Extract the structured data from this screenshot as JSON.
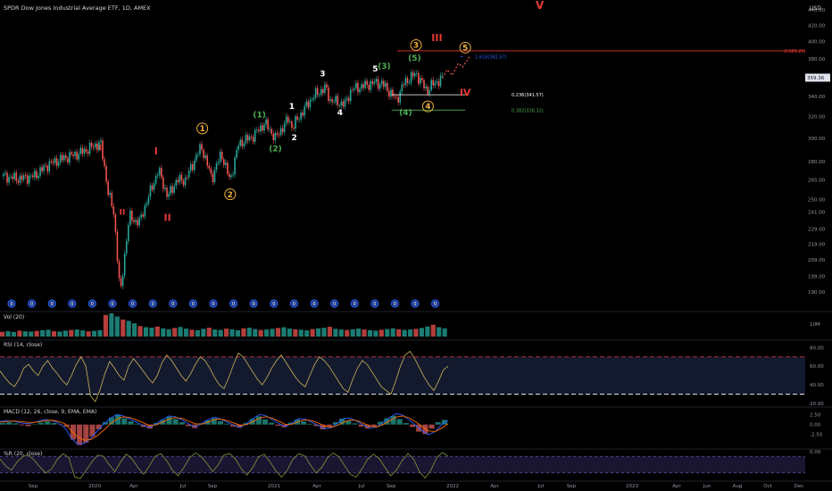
{
  "header": {
    "title": "SPDR Dow Jones Industrial Average ETF, 1D, AMEX",
    "currency": "USD"
  },
  "colors": {
    "background": "#000000",
    "candle_up": "#26a69a",
    "candle_down": "#ef5350",
    "rsi_line": "#c9b458",
    "macd_line": "#2962ff",
    "signal_line": "#ff6d00",
    "wr_line": "#7e9c3c",
    "wave_orange": "#f0b040",
    "wave_red": "#e53935",
    "wave_green": "#4caf50",
    "wave_white": "#ffffff",
    "fib_blue": "#2962ff"
  },
  "price_axis": {
    "ticks": [
      "440.00",
      "420.00",
      "400.00",
      "380.00",
      "360.00",
      "340.00",
      "320.00",
      "300.00",
      "280.00",
      "265.00",
      "250.00",
      "241.00",
      "229.00",
      "219.00",
      "209.00",
      "199.00",
      "190.00"
    ],
    "last_price": "359.36"
  },
  "time_axis": {
    "labels": [
      "Sep",
      "2020",
      "Apr",
      "Jul",
      "Sep",
      "2021",
      "Apr",
      "Jul",
      "Sep",
      "2022",
      "Apr",
      "Jul",
      "Sep",
      "2023",
      "Apr",
      "Jun",
      "Aug",
      "Oct",
      "Dec"
    ]
  },
  "chart_data": [
    {
      "type": "line",
      "title": "SPDR Dow Jones Industrial Average ETF, 1D, AMEX",
      "subtitle": "candlestick",
      "x_unit": "date",
      "series": [
        {
          "name": "",
          "values": [
            {
              "x": "2019-08-01",
              "y": 268
            },
            {
              "x": "2019-09-01",
              "y": 266
            },
            {
              "x": "2019-10-01",
              "y": 268
            },
            {
              "x": "2019-11-01",
              "y": 278
            },
            {
              "x": "2019-12-01",
              "y": 283
            },
            {
              "x": "2020-01-01",
              "y": 287
            },
            {
              "x": "2020-02-12",
              "y": 296
            },
            {
              "x": "2020-02-28",
              "y": 255
            },
            {
              "x": "2020-03-10",
              "y": 240
            },
            {
              "x": "2020-03-23",
              "y": 187
            },
            {
              "x": "2020-04-10",
              "y": 238
            },
            {
              "x": "2020-04-20",
              "y": 235
            },
            {
              "x": "2020-05-01",
              "y": 234
            },
            {
              "x": "2020-06-08",
              "y": 273
            },
            {
              "x": "2020-06-26",
              "y": 252
            },
            {
              "x": "2020-07-15",
              "y": 265
            },
            {
              "x": "2020-08-01",
              "y": 265
            },
            {
              "x": "2020-09-02",
              "y": 293
            },
            {
              "x": "2020-09-23",
              "y": 266
            },
            {
              "x": "2020-10-12",
              "y": 287
            },
            {
              "x": "2020-10-30",
              "y": 264
            },
            {
              "x": "2020-11-16",
              "y": 295
            },
            {
              "x": "2020-12-15",
              "y": 302
            },
            {
              "x": "2021-01-08",
              "y": 314
            },
            {
              "x": "2021-01-29",
              "y": 300
            },
            {
              "x": "2021-02-24",
              "y": 318
            },
            {
              "x": "2021-03-04",
              "y": 310
            },
            {
              "x": "2021-04-15",
              "y": 340
            },
            {
              "x": "2021-05-10",
              "y": 349
            },
            {
              "x": "2021-05-19",
              "y": 336
            },
            {
              "x": "2021-06-18",
              "y": 332
            },
            {
              "x": "2021-07-01",
              "y": 347
            },
            {
              "x": "2021-08-16",
              "y": 354
            },
            {
              "x": "2021-09-01",
              "y": 353
            },
            {
              "x": "2021-09-30",
              "y": 336
            },
            {
              "x": "2021-10-15",
              "y": 354
            },
            {
              "x": "2021-11-08",
              "y": 364
            },
            {
              "x": "2021-11-30",
              "y": 345
            },
            {
              "x": "2021-12-06",
              "y": 350
            },
            {
              "x": "2021-12-17",
              "y": 354
            },
            {
              "x": "2021-12-31",
              "y": 359
            }
          ]
        }
      ],
      "projection": [
        {
          "x": "2021-12-31",
          "y": 359
        },
        {
          "x": "2022-01-10",
          "y": 368
        },
        {
          "x": "2022-01-20",
          "y": 362
        },
        {
          "x": "2022-02-01",
          "y": 375
        },
        {
          "x": "2022-02-10",
          "y": 371
        },
        {
          "x": "2022-02-24",
          "y": 383
        }
      ],
      "ylim": [
        185,
        448
      ],
      "xlim": [
        "2019-07-25",
        "2023-12-31"
      ],
      "y_scale": "log",
      "grid": false,
      "levels": [
        {
          "label": "2(389.26)",
          "y": 389.26,
          "color": "#e53935",
          "from": "2021-10-01",
          "to": "2023-12-31"
        },
        {
          "label": "1.618(382.57)",
          "y": 382.57,
          "color": "#2962ff",
          "from": "2022-02-05",
          "to": "2022-02-10"
        },
        {
          "label": "0.236(341.57)",
          "y": 341.57,
          "color": "#ffffff",
          "from": "2021-09-20",
          "to": "2022-02-15"
        },
        {
          "label": "0.382(326.32)",
          "y": 326.32,
          "color": "#4caf50",
          "from": "2021-09-20",
          "to": "2022-02-15"
        }
      ],
      "annotations": [
        {
          "text": "V",
          "x": "2022-07-15",
          "y": 446,
          "color": "#e53935",
          "size": 12,
          "circled": false
        },
        {
          "text": "III",
          "x": "2021-12-20",
          "y": 405,
          "color": "#e53935",
          "size": 11,
          "circled": false
        },
        {
          "text": "IV",
          "x": "2022-02-15",
          "y": 344,
          "color": "#e53935",
          "size": 11,
          "circled": false
        },
        {
          "text": "I",
          "x": "2020-06-03",
          "y": 289,
          "color": "#e53935",
          "size": 11,
          "circled": false
        },
        {
          "text": "II",
          "x": "2020-06-26",
          "y": 237,
          "color": "#e53935",
          "size": 11,
          "circled": false
        },
        {
          "text": "I",
          "x": "2020-02-12",
          "y": 292,
          "color": "#e53935",
          "size": 9,
          "circled": false
        },
        {
          "text": "II",
          "x": "2020-03-27",
          "y": 241,
          "color": "#e53935",
          "size": 9,
          "circled": false
        },
        {
          "text": "1",
          "x": "2020-09-04",
          "y": 309,
          "color": "#f0b040",
          "size": 9,
          "circled": true
        },
        {
          "text": "2",
          "x": "2020-10-30",
          "y": 254,
          "color": "#f0b040",
          "size": 9,
          "circled": true
        },
        {
          "text": "3",
          "x": "2021-11-08",
          "y": 396,
          "color": "#f0b040",
          "size": 9,
          "circled": true
        },
        {
          "text": "4",
          "x": "2021-12-02",
          "y": 330,
          "color": "#f0b040",
          "size": 9,
          "circled": true
        },
        {
          "text": "5",
          "x": "2022-02-15",
          "y": 393,
          "color": "#f0b040",
          "size": 9,
          "circled": true
        },
        {
          "text": "(1)",
          "x": "2020-12-28",
          "y": 322,
          "color": "#4caf50",
          "size": 9,
          "circled": false
        },
        {
          "text": "(2)",
          "x": "2021-01-29",
          "y": 291,
          "color": "#4caf50",
          "size": 9,
          "circled": false
        },
        {
          "text": "(3)",
          "x": "2021-09-05",
          "y": 372,
          "color": "#4caf50",
          "size": 9,
          "circled": false
        },
        {
          "text": "(4)",
          "x": "2021-10-18",
          "y": 324,
          "color": "#4caf50",
          "size": 9,
          "circled": false
        },
        {
          "text": "(5)",
          "x": "2021-11-05",
          "y": 381,
          "color": "#4caf50",
          "size": 9,
          "circled": false
        },
        {
          "text": "1",
          "x": "2021-03-03",
          "y": 330,
          "color": "#ffffff",
          "size": 9,
          "circled": false
        },
        {
          "text": "2",
          "x": "2021-03-08",
          "y": 301,
          "color": "#ffffff",
          "size": 9,
          "circled": false
        },
        {
          "text": "3",
          "x": "2021-05-04",
          "y": 364,
          "color": "#ffffff",
          "size": 9,
          "circled": false
        },
        {
          "text": "4",
          "x": "2021-06-08",
          "y": 324,
          "color": "#ffffff",
          "size": 9,
          "circled": false
        },
        {
          "text": "5",
          "x": "2021-08-18",
          "y": 369,
          "color": "#ffffff",
          "size": 9,
          "circled": false
        }
      ],
      "markers": {
        "count": 22,
        "text": "0"
      }
    },
    {
      "type": "bar",
      "title": "Vol (20)",
      "axis_ticks": [
        "10M"
      ],
      "values": [
        2.1,
        2.4,
        2.0,
        2.6,
        2.3,
        2.2,
        2.5,
        2.8,
        3.0,
        2.4,
        2.2,
        2.6,
        2.9,
        3.1,
        2.7,
        2.3,
        2.5,
        2.8,
        9.5,
        10.2,
        8.8,
        7.5,
        6.9,
        5.8,
        4.6,
        4.1,
        3.9,
        4.4,
        3.6,
        3.2,
        3.8,
        4.2,
        3.5,
        3.0,
        2.8,
        3.4,
        3.9,
        3.1,
        2.9,
        3.5,
        3.2,
        2.8,
        3.6,
        3.9,
        3.3,
        2.9,
        3.1,
        3.4,
        3.8,
        4.1,
        3.5,
        3.2,
        3.0,
        2.7,
        3.3,
        3.6,
        3.9,
        4.3,
        3.4,
        3.1,
        2.9,
        3.2,
        3.5,
        3.1,
        2.8,
        2.6,
        3.0,
        3.3,
        3.6,
        3.2,
        2.9,
        3.1,
        3.4,
        3.8,
        4.4,
        5.2,
        4.1,
        3.6
      ],
      "ma_label": "20"
    },
    {
      "type": "line",
      "title": "RSI (14, close)",
      "axis_ticks": [
        "80.00",
        "60.00",
        "40.00",
        "20.00"
      ],
      "ylim": [
        20,
        86
      ],
      "bands": [
        70,
        30
      ],
      "values": [
        55,
        48,
        42,
        38,
        46,
        58,
        62,
        55,
        50,
        60,
        66,
        58,
        52,
        45,
        40,
        50,
        62,
        70,
        60,
        28,
        22,
        35,
        52,
        65,
        58,
        50,
        45,
        60,
        68,
        62,
        55,
        48,
        42,
        50,
        64,
        72,
        66,
        58,
        50,
        44,
        52,
        62,
        70,
        66,
        58,
        48,
        40,
        36,
        48,
        62,
        74,
        70,
        62,
        54,
        46,
        40,
        48,
        58,
        66,
        72,
        64,
        56,
        48,
        42,
        38,
        50,
        62,
        70,
        66,
        60,
        52,
        44,
        36,
        32,
        46,
        58,
        66,
        62,
        54,
        46,
        38,
        34,
        30,
        44,
        60,
        72,
        76,
        68,
        58,
        48,
        40,
        34,
        44,
        56,
        60
      ]
    },
    {
      "type": "bar",
      "title": "MACD (12, 26, close, 9, EMA, EMA)",
      "axis_ticks": [
        "2.50",
        "0.00",
        "-2.50"
      ],
      "ylim": [
        -6,
        4
      ],
      "values": [
        0.4,
        0.6,
        0.3,
        -0.2,
        -0.4,
        0.1,
        0.5,
        0.8,
        0.4,
        -0.1,
        -0.5,
        -3.8,
        -5.2,
        -4.6,
        -3.0,
        -1.2,
        0.6,
        1.8,
        2.4,
        1.6,
        0.8,
        0.2,
        -0.6,
        -1.0,
        0.4,
        1.2,
        2.0,
        1.4,
        0.6,
        -0.4,
        -0.9,
        0.3,
        1.1,
        1.6,
        0.9,
        0.2,
        -0.5,
        -0.8,
        0.4,
        1.4,
        2.1,
        1.3,
        0.5,
        -0.3,
        -0.7,
        0.5,
        1.3,
        0.8,
        0.2,
        -0.4,
        -1.2,
        -0.6,
        0.6,
        1.5,
        1.0,
        0.3,
        -0.5,
        -1.0,
        -0.4,
        0.7,
        1.6,
        2.2,
        1.4,
        0.4,
        -0.6,
        -1.8,
        -2.4,
        -1.0,
        0.6,
        1.2
      ],
      "macd_line": [
        0.8,
        1.0,
        0.9,
        0.5,
        0.2,
        0.4,
        0.9,
        1.3,
        1.0,
        0.4,
        -0.8,
        -3.5,
        -5.0,
        -4.8,
        -3.4,
        -1.6,
        0.2,
        1.6,
        2.6,
        2.2,
        1.4,
        0.6,
        -0.2,
        -0.8,
        0.2,
        1.2,
        2.2,
        2.0,
        1.2,
        0.2,
        -0.6,
        0.2,
        1.2,
        1.9,
        1.4,
        0.6,
        -0.2,
        -0.7,
        0.3,
        1.6,
        2.6,
        2.2,
        1.2,
        0.2,
        -0.5,
        0.4,
        1.5,
        1.4,
        0.6,
        -0.2,
        -1.1,
        -0.8,
        0.4,
        1.6,
        1.6,
        0.8,
        -0.2,
        -0.9,
        -0.6,
        0.6,
        1.8,
        2.8,
        2.4,
        1.2,
        -0.2,
        -1.6,
        -2.6,
        -1.8,
        0.0,
        1.0
      ],
      "signal_line": [
        0.6,
        0.8,
        0.9,
        0.8,
        0.6,
        0.5,
        0.7,
        1.0,
        1.1,
        0.8,
        0.2,
        -1.6,
        -3.2,
        -4.0,
        -3.8,
        -2.8,
        -1.4,
        0.2,
        1.4,
        2.0,
        1.8,
        1.2,
        0.5,
        -0.2,
        -0.1,
        0.6,
        1.4,
        1.8,
        1.6,
        0.9,
        0.2,
        0.1,
        0.6,
        1.3,
        1.4,
        1.0,
        0.4,
        -0.2,
        0.0,
        0.8,
        1.7,
        2.0,
        1.6,
        0.8,
        0.0,
        0.1,
        0.8,
        1.2,
        1.0,
        0.4,
        -0.4,
        -0.7,
        -0.2,
        0.7,
        1.2,
        1.0,
        0.3,
        -0.4,
        -0.6,
        0.0,
        1.0,
        1.9,
        2.2,
        1.7,
        0.7,
        -0.5,
        -1.6,
        -1.8,
        -0.9,
        0.2
      ]
    },
    {
      "type": "line",
      "title": "%R (20, close)",
      "axis_ticks": [
        "0.00"
      ],
      "ylim": [
        -100,
        0
      ],
      "bands": [
        -20,
        -80
      ],
      "values": [
        -30,
        -55,
        -70,
        -40,
        -20,
        -15,
        -35,
        -60,
        -80,
        -65,
        -30,
        -10,
        -25,
        -95,
        -100,
        -70,
        -40,
        -15,
        -20,
        -50,
        -75,
        -40,
        -12,
        -30,
        -60,
        -85,
        -55,
        -20,
        -10,
        -35,
        -70,
        -90,
        -60,
        -25,
        -8,
        -20,
        -45,
        -75,
        -50,
        -15,
        -10,
        -30,
        -65,
        -88,
        -60,
        -22,
        -12,
        -40,
        -72,
        -95,
        -70,
        -30,
        -10,
        -18,
        -50,
        -80,
        -60,
        -25,
        -8,
        -22,
        -55,
        -85,
        -95,
        -65,
        -30,
        -12,
        -28,
        -60,
        -90,
        -70,
        -35,
        -10,
        -30,
        -75,
        -98,
        -70,
        -25,
        -6,
        -20
      ]
    }
  ]
}
